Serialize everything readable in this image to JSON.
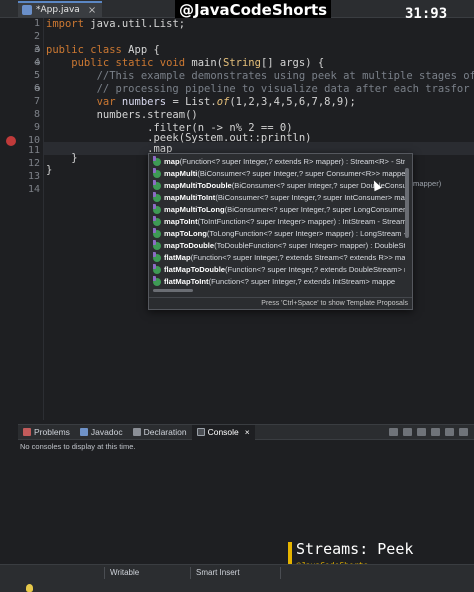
{
  "overlay": {
    "handle": "@JavaCodeShorts",
    "timer": "31:93",
    "title": "Streams: Peek",
    "subtitle": "@JavaCodeShorts"
  },
  "editor": {
    "tab_label": "*App.java",
    "line_numbers": [
      "1",
      "2",
      "3",
      "4",
      "5",
      "6",
      "7",
      "8",
      "9",
      "10",
      "11",
      "12",
      "13",
      "14"
    ],
    "lines": {
      "l1_kw": "import",
      "l1_rest": " java.util.List;",
      "l3_kw": "public class",
      "l3_rest": " App {",
      "l4_kw": "    public static void",
      "l4_m": " main(",
      "l4_t": "String",
      "l4_rest": "[] args) {",
      "l5": "        //This example demonstrates using peek at multiple stages of",
      "l6": "        // processing pipeline to visualize data after each trasfor",
      "l7_kw": "        var",
      "l7_v": " numbers",
      "l7_rest": " = List.",
      "l7_of": "of",
      "l7_end": "(1,2,3,4,5,6,7,8,9);",
      "l8": "        numbers.stream()",
      "l9": "                .filter(n -> n% 2 == 0)",
      "l10": "                .peek(System.out::println)",
      "l11": "                .map",
      "l12": "    }",
      "l13": "}"
    }
  },
  "completion": {
    "items": [
      {
        "name": "map",
        "sig": "(Function<? super Integer,? extends R> mapper) : Stream<R> - Strea"
      },
      {
        "name": "mapMulti",
        "sig": "(BiConsumer<? super Integer,? super Consumer<R>> mappe"
      },
      {
        "name": "mapMultiToDouble",
        "sig": "(BiConsumer<? super Integer,? super DoubleConsumer> mapper)"
      },
      {
        "name": "mapMultiToInt",
        "sig": "(BiConsumer<? super Integer,? super IntConsumer> mappe"
      },
      {
        "name": "mapMultiToLong",
        "sig": "(BiConsumer<? super Integer,? super LongConsumer> m"
      },
      {
        "name": "mapToInt",
        "sig": "(ToIntFunction<? super Integer> mapper) : IntStream - Stream"
      },
      {
        "name": "mapToLong",
        "sig": "(ToLongFunction<? super Integer> mapper) : LongStream - S"
      },
      {
        "name": "mapToDouble",
        "sig": "(ToDoubleFunction<? super Integer> mapper) : DoubleStre"
      },
      {
        "name": "flatMap",
        "sig": "(Function<? super Integer,? extends Stream<? extends R>> mapp"
      },
      {
        "name": "flatMapToDouble",
        "sig": "(Function<? super Integer,? extends DoubleStream> m"
      },
      {
        "name": "flatMapToInt",
        "sig": "(Function<? super Integer,? extends IntStream> mappe"
      }
    ],
    "hover_tail": "mapper)",
    "footer": "Press 'Ctrl+Space' to show Template Proposals"
  },
  "panel": {
    "tabs": [
      "Problems",
      "Javadoc",
      "Declaration",
      "Console"
    ],
    "active_tab": "Console",
    "console_message": "No consoles to display at this time."
  },
  "status": {
    "mode": "Writable",
    "insert": "Smart Insert"
  }
}
